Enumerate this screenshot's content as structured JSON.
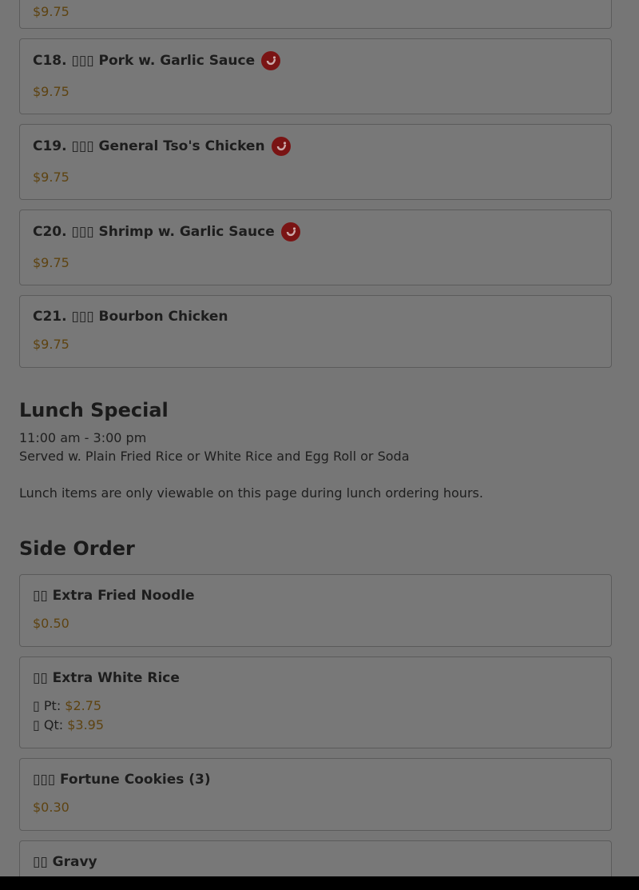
{
  "top_partial_price": "$9.75",
  "items": [
    {
      "title": "C18. ▯▯▯ Pork w. Garlic Sauce",
      "price": "$9.75",
      "spicy": true
    },
    {
      "title": "C19. ▯▯▯ General Tso's Chicken",
      "price": "$9.75",
      "spicy": true
    },
    {
      "title": "C20. ▯▯▯ Shrimp w. Garlic Sauce",
      "price": "$9.75",
      "spicy": true
    },
    {
      "title": "C21. ▯▯▯ Bourbon Chicken",
      "price": "$9.75",
      "spicy": false
    }
  ],
  "lunch": {
    "title": "Lunch Special",
    "hours": "11:00 am - 3:00 pm",
    "served": "Served w. Plain Fried Rice or White Rice and Egg Roll or Soda",
    "note": "Lunch items are only viewable on this page during lunch ordering hours."
  },
  "side": {
    "title": "Side Order",
    "items": [
      {
        "title": "▯▯ Extra Fried Noodle",
        "price": "$0.50"
      },
      {
        "title": "▯▯ Extra White Rice",
        "sizes": [
          {
            "label": "▯ Pt: ",
            "price": "$2.75"
          },
          {
            "label": "▯ Qt: ",
            "price": "$3.95"
          }
        ]
      },
      {
        "title": "▯▯▯ Fortune Cookies (3)",
        "price": "$0.30"
      },
      {
        "title": "▯▯ Gravy"
      }
    ]
  },
  "colors": {
    "overlay_bg": "#767676",
    "price": "#5e4311",
    "spicy_badge": "#7a1414"
  },
  "icons": {
    "spicy": "chili-pepper-icon"
  }
}
